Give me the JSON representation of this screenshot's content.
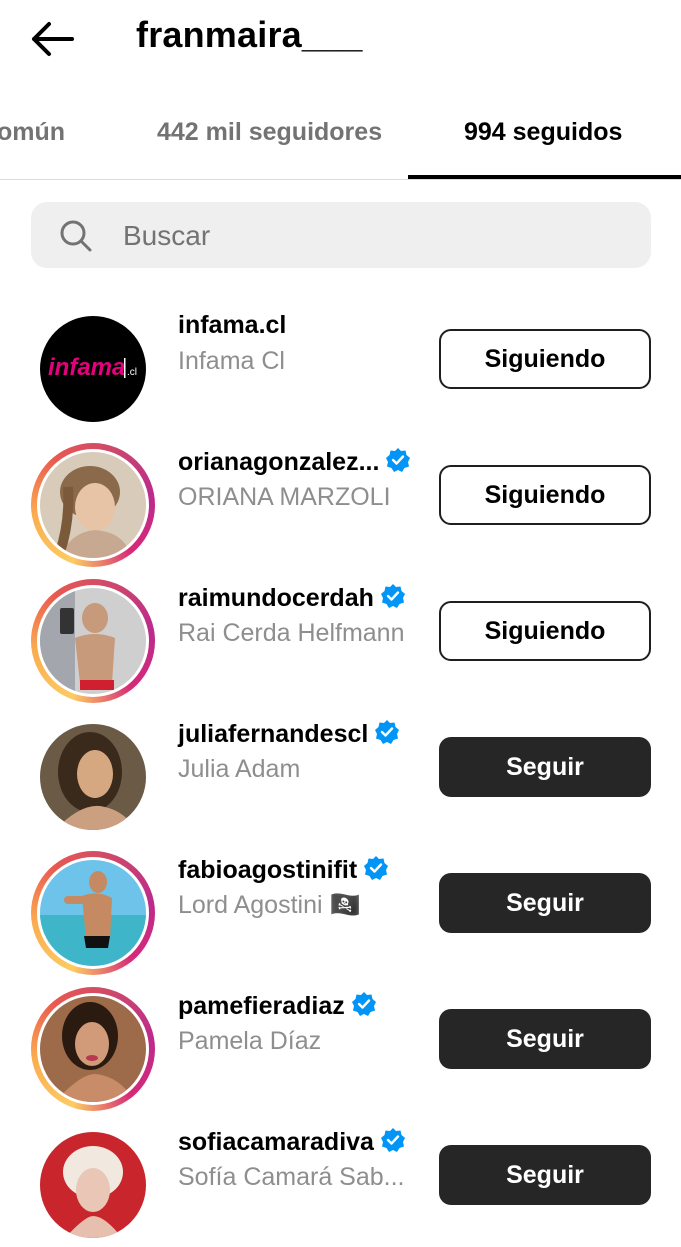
{
  "header": {
    "title": "franmaira___",
    "back_icon": "arrow-left-icon"
  },
  "tabs": [
    {
      "label": "omún",
      "active": false
    },
    {
      "label": "442 mil seguidores",
      "active": false
    },
    {
      "label": "994 seguidos",
      "active": true
    }
  ],
  "search": {
    "placeholder": "Buscar",
    "value": ""
  },
  "accounts": [
    {
      "username": "infama.cl",
      "fullname": "Infama Cl",
      "verified": false,
      "has_story": false,
      "button": "Siguiendo",
      "logo_text": "infama",
      "logo_suffix": ".cl"
    },
    {
      "username": "orianagonzalez...",
      "fullname": "ORIANA MARZOLI",
      "verified": true,
      "has_story": true,
      "button": "Siguiendo"
    },
    {
      "username": "raimundocerdah",
      "fullname": "Rai Cerda Helfmann",
      "verified": true,
      "has_story": true,
      "button": "Siguiendo"
    },
    {
      "username": "juliafernandescl",
      "fullname": "Julia Adam",
      "verified": true,
      "has_story": false,
      "button": "Seguir"
    },
    {
      "username": "fabioagostinifit",
      "fullname": "Lord Agostini 🏴‍☠️",
      "verified": true,
      "has_story": true,
      "button": "Seguir"
    },
    {
      "username": "pamefieradiaz",
      "fullname": "Pamela Díaz",
      "verified": true,
      "has_story": true,
      "button": "Seguir"
    },
    {
      "username": "sofiacamaradiva",
      "fullname": "Sofía Camará Sab...",
      "verified": true,
      "has_story": false,
      "button": "Seguir"
    }
  ],
  "colors": {
    "follow_button": "#262626",
    "verified": "#0095f6",
    "tab_inactive": "#737373",
    "subtitle": "#8e8e8e"
  }
}
